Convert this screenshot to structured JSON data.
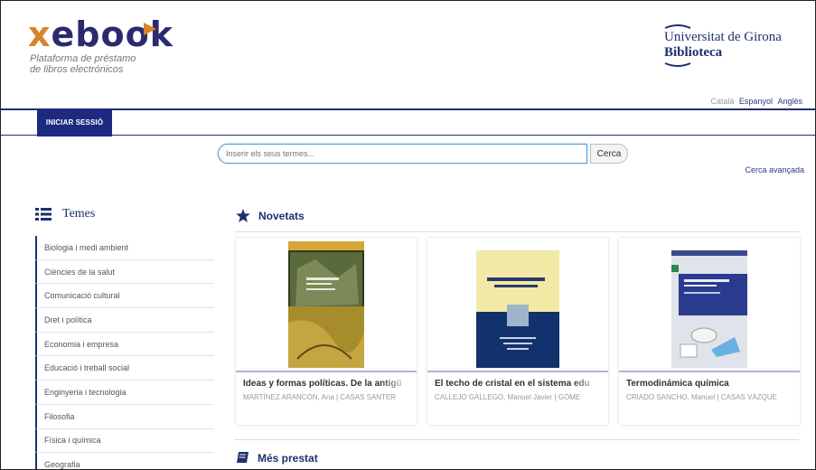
{
  "header": {
    "logo_x": "x",
    "logo_rest": "ebook",
    "tagline_line1": "Plataforma de préstamo",
    "tagline_line2": "de libros electrónicos",
    "university_name": "Universitat de Girona",
    "university_library": "Biblioteca",
    "languages": [
      {
        "label": "Català",
        "active": false
      },
      {
        "label": "Espanyol",
        "active": true
      },
      {
        "label": "Anglès",
        "active": true
      }
    ]
  },
  "nav": {
    "login_label": "INICIAR SESSIÓ"
  },
  "search": {
    "placeholder": "Inserir els seus termes...",
    "button_label": "Cerca",
    "advanced_label": "Cerca avançada"
  },
  "sidebar": {
    "title": "Temes",
    "items": [
      {
        "label": "Biologia i medi ambient"
      },
      {
        "label": "Ciències de la salut"
      },
      {
        "label": "Comunicació cultural"
      },
      {
        "label": "Dret i política"
      },
      {
        "label": "Economia i empresa"
      },
      {
        "label": "Educació i treball social"
      },
      {
        "label": "Enginyeria i tecnologia"
      },
      {
        "label": "Filosofia"
      },
      {
        "label": "Física i química"
      },
      {
        "label": "Geografia"
      }
    ]
  },
  "novetats": {
    "title": "Novetats",
    "books": [
      {
        "title": "Ideas y formas políticas. De la antigü",
        "author": "MARTÍNEZ ARANCÓN, Ana | CASAS SANTER"
      },
      {
        "title": "El techo de cristal en el sistema edu",
        "author": "CALLEJO GALLEGO, Manuel Javier | GÓME"
      },
      {
        "title": "Termodinámica química",
        "author": "CRIADO SANCHO, Manuel | CASAS VÁZQUE"
      }
    ]
  },
  "mes_prestat": {
    "title": "Més prestat"
  },
  "colors": {
    "brand_navy": "#1f2f6e",
    "button_navy": "#1d2a80",
    "logo_orange": "#d8842a"
  }
}
